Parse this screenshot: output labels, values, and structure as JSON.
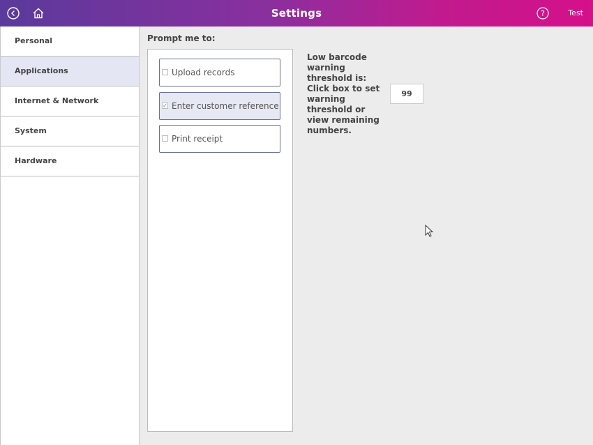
{
  "header": {
    "title": "Settings",
    "user": "Test",
    "back_icon": "back-icon",
    "home_icon": "home-icon",
    "help_icon": "help-icon"
  },
  "sidebar": {
    "items": [
      {
        "label": "Personal",
        "active": false
      },
      {
        "label": "Applications",
        "active": true
      },
      {
        "label": "Internet & Network",
        "active": false
      },
      {
        "label": "System",
        "active": false
      },
      {
        "label": "Hardware",
        "active": false
      }
    ]
  },
  "main": {
    "prompt_heading": "Prompt me to:",
    "options": [
      {
        "label": "Upload records",
        "checked": false
      },
      {
        "label": "Enter customer reference",
        "checked": true
      },
      {
        "label": "Print receipt",
        "checked": false
      }
    ],
    "threshold": {
      "text": "Low barcode warning threshold is: Click box to set warning threshold or view remaining numbers.",
      "value": "99"
    }
  },
  "colors": {
    "header_start": "#5a3a9c",
    "header_end": "#d4108a",
    "active_item": "#e4e6f3",
    "option_border": "#6a6f96"
  }
}
